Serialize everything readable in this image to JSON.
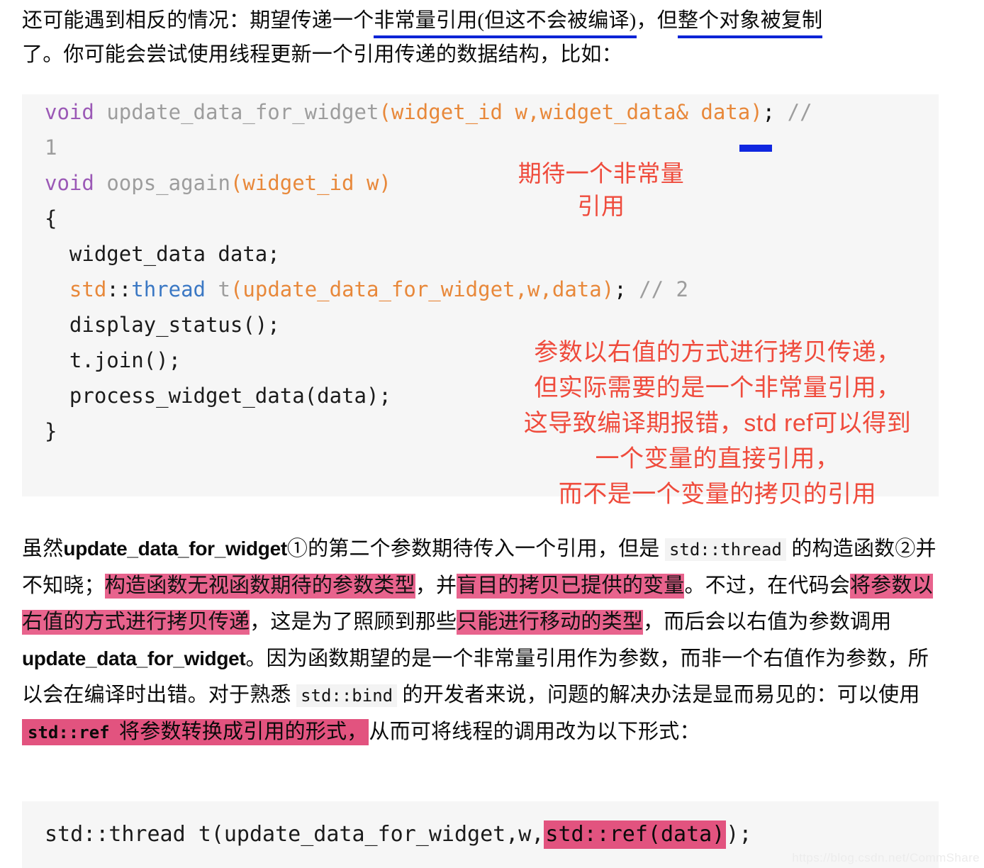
{
  "document": {
    "intro_paragraph": {
      "line1_a": "还可能遇到相反的情况：期望传递一个",
      "line1_underlined_1": "非常量引用(但这不会被编译)",
      "line1_b": "，但",
      "line1_underlined_2": "整个对象被复制",
      "line2": "了。你可能会尝试使用线程更新一个引用传递的数据结构，比如："
    },
    "code_main": {
      "lines": [
        {
          "tokens": [
            {
              "text": "void",
              "kind": "keyword"
            },
            {
              "text": " ",
              "kind": "plain"
            },
            {
              "text": "update_data_for_widget",
              "kind": "function"
            },
            {
              "text": "(widget_id w,widget_data& data)",
              "kind": "punctuation"
            },
            {
              "text": ";",
              "kind": "semicolon"
            },
            {
              "text": " ",
              "kind": "plain"
            },
            {
              "text": "//",
              "kind": "comment"
            }
          ]
        },
        {
          "tokens": [
            {
              "text": "1",
              "kind": "comment"
            }
          ]
        },
        {
          "tokens": [
            {
              "text": "void",
              "kind": "keyword"
            },
            {
              "text": " ",
              "kind": "plain"
            },
            {
              "text": "oops_again",
              "kind": "function"
            },
            {
              "text": "(widget_id w)",
              "kind": "punctuation"
            }
          ]
        },
        {
          "tokens": [
            {
              "text": "{",
              "kind": "plain"
            }
          ]
        },
        {
          "tokens": [
            {
              "text": "  widget_data data;",
              "kind": "plain"
            }
          ]
        },
        {
          "tokens": [
            {
              "text": "  ",
              "kind": "plain"
            },
            {
              "text": "std",
              "kind": "namespace"
            },
            {
              "text": "::",
              "kind": "plain"
            },
            {
              "text": "thread",
              "kind": "type"
            },
            {
              "text": " ",
              "kind": "plain"
            },
            {
              "text": "t",
              "kind": "function"
            },
            {
              "text": "(update_data_for_widget,w,data)",
              "kind": "punctuation"
            },
            {
              "text": ";",
              "kind": "semicolon"
            },
            {
              "text": " ",
              "kind": "plain"
            },
            {
              "text": "// 2",
              "kind": "comment"
            }
          ]
        },
        {
          "tokens": [
            {
              "text": "  display_status();",
              "kind": "plain"
            }
          ]
        },
        {
          "tokens": [
            {
              "text": "  t.join();",
              "kind": "plain"
            }
          ]
        },
        {
          "tokens": [
            {
              "text": "  process_widget_data(data);",
              "kind": "plain"
            }
          ]
        },
        {
          "tokens": [
            {
              "text": "}",
              "kind": "plain"
            }
          ]
        }
      ]
    },
    "annotations": {
      "top": "期待一个非常量\n引用",
      "main": "参数以右值的方式进行拷贝传递，\n但实际需要的是一个非常量引用，\n这导致编译期报错，std ref可以得到\n一个变量的直接引用，\n而不是一个变量的拷贝的引用",
      "color": "#ef4b3c"
    },
    "body_paragraph": {
      "seg_1": "虽然",
      "seg_2_code": "update_data_for_widget",
      "seg_3": "①的第二个参数期待传入一个引用，但是 ",
      "seg_4_chip": "std::thread",
      "seg_5": " 的构造函数②并不知晓；",
      "seg_6_hl": "构造函数无视函数期待的参数类型",
      "seg_7": "，并",
      "seg_8_hl": "盲目的拷贝已提供的变量",
      "seg_9": "。不过，在代码会",
      "seg_10_hl": "将参数以右值的方式进行拷贝传递",
      "seg_11": "，这是为了照顾到那些",
      "seg_12_hl": "只能进行移动的类型",
      "seg_13": "，而后会以右值为参数调用",
      "seg_14_code": "update_data_for_widget",
      "seg_15": "。因为函数期望的是一个非常量引用作为参数，而非一个右值作为参数，所以会在编译时出错。对于熟悉 ",
      "seg_16_chip": "std::bind",
      "seg_17": " 的开发者来说，问题的解决办法是显而易见的：可以使用",
      "seg_18_hl_chip": "std::ref",
      "seg_19_hl": " 将参数转换成引用的形式，",
      "seg_20": "从而可将线程的调用改为以下形式："
    },
    "code_final": {
      "prefix": "std::thread t(update_data_for_widget,w,",
      "highlight": "std::ref(data)",
      "suffix": ");"
    },
    "watermark": "https://blog.csdn.net/CommShare",
    "colors": {
      "code_background": "#f6f6f6",
      "keyword": "#9b59b6",
      "function": "#9d9d9d",
      "punctuation": "#e8883a",
      "type": "#3b78c4",
      "comment": "#9d9d9d",
      "annotation_red": "#ef4b3c",
      "highlight_pink": "#e8638d",
      "underline_blue": "#1027e0"
    }
  }
}
